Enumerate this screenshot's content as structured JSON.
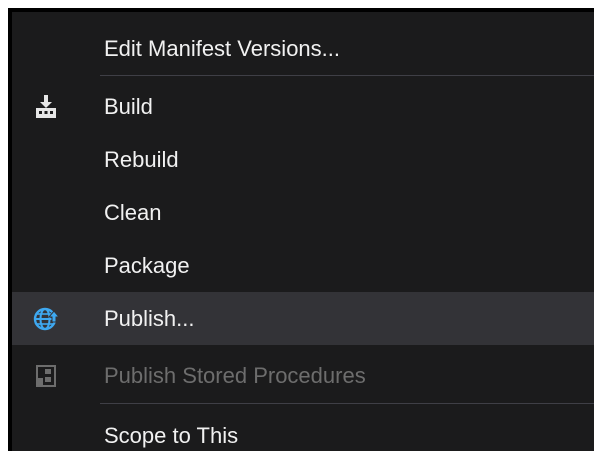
{
  "menu": {
    "items": [
      {
        "label": "Edit Manifest Versions...",
        "icon": "none"
      },
      {
        "label": "Build",
        "icon": "build-icon"
      },
      {
        "label": "Rebuild",
        "icon": "none"
      },
      {
        "label": "Clean",
        "icon": "none"
      },
      {
        "label": "Package",
        "icon": "none"
      },
      {
        "label": "Publish...",
        "icon": "publish-web-icon",
        "highlighted": true
      },
      {
        "label": "Publish Stored Procedures",
        "icon": "publish-stored-procedures-icon",
        "disabled": true
      },
      {
        "label": "Scope to This",
        "icon": "none"
      }
    ]
  },
  "colors": {
    "menu_background": "#1b1b1c",
    "highlight": "#333337",
    "text": "#f1f1f1",
    "disabled_text": "#6d6d6d",
    "separator": "#3f3f46",
    "globe_blue": "#3ea8f0"
  }
}
